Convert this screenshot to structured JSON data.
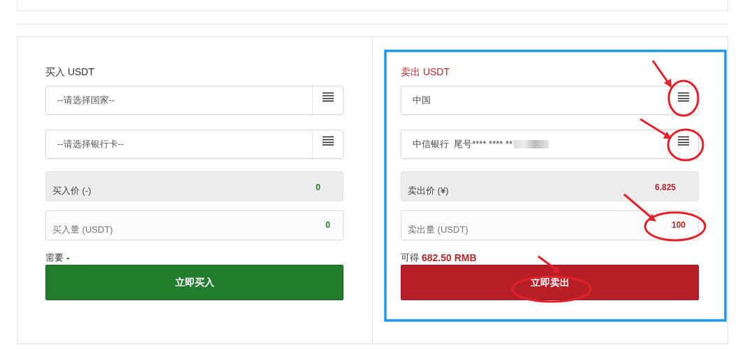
{
  "panels": [
    {
      "kind": "buy",
      "title": "买入 USDT",
      "highlighted": false,
      "country": {
        "placeholder": "--请选择国家--"
      },
      "bank": {
        "placeholder": "--请选择银行卡--",
        "redacted": false
      },
      "price": {
        "label": "买入价 (-)",
        "value": "0"
      },
      "amount": {
        "label": "买入量 (USDT)",
        "value": "0"
      },
      "summary": {
        "label": "需要",
        "value": "-"
      },
      "button": "立即买入"
    },
    {
      "kind": "sell",
      "title": "卖出 USDT",
      "highlighted": true,
      "country": {
        "value": "中国"
      },
      "bank": {
        "value": "中信银行  尾号**** **** **",
        "redacted": true
      },
      "price": {
        "label": "卖出价 (¥)",
        "value": "6.825"
      },
      "amount": {
        "label": "卖出量 (USDT)",
        "value": "100"
      },
      "summary": {
        "label": "可得",
        "value": "682.50 RMB"
      },
      "button": "立即卖出"
    }
  ]
}
